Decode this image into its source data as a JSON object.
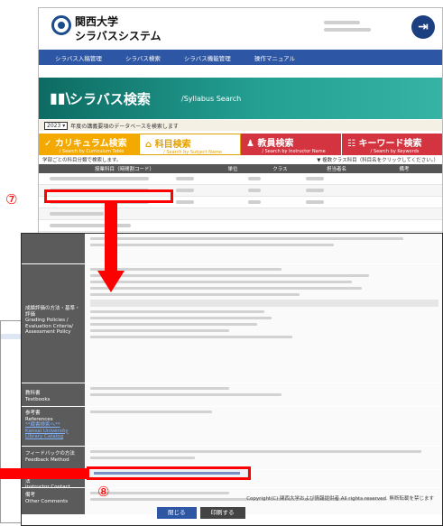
{
  "app": {
    "university": "関西大学",
    "system_name": "シラバスシステム",
    "logout_glyph": "⇥"
  },
  "nav": {
    "items": [
      "シラバス入稿管理",
      "シラバス検索",
      "シラバス機能管理",
      "操作マニュアル"
    ]
  },
  "search": {
    "icon": "books-icon",
    "title": "シラバス検索",
    "subtitle": "/Syllabus Search",
    "year_value": "2023",
    "year_suffix": "年度の講義要項のデータベースを検索します",
    "tabs": [
      {
        "label": "カリキュラム検索",
        "sub": "/ Search by Curriculum Table",
        "glyph": "✓"
      },
      {
        "label": "科目検索",
        "sub": "/ Search by Subject Name",
        "glyph": "⌂"
      },
      {
        "label": "教員検索",
        "sub": "/ Search by Instructor Name",
        "glyph": "♟"
      },
      {
        "label": "キーワード検索",
        "sub": "/ Search by Keywords",
        "glyph": "☷"
      }
    ],
    "note_left": "学部ごとの科目分類で検索します。",
    "note_right": "▼ 複数クラス科目（科目名をクリックしてください。）",
    "columns": [
      "授業科目（時間割コード）",
      "単位",
      "クラス",
      "担当者名",
      "備考"
    ]
  },
  "detail": {
    "rows": [
      {
        "label": ""
      },
      {
        "label": "成績評価の方法・基準・評価\nGrading Policies / Evaluation Criteria/ Assessment Policy"
      },
      {
        "label": "教科書\nTextbooks"
      },
      {
        "label": "参考書\nReferences"
      },
      {
        "link": "**蔵書検索へ**"
      },
      {
        "link": "Kansai University Library Catalog"
      },
      {
        "label": "フィードバックの方法\nFeedback Method"
      },
      {
        "label": "授業者への問い合わせ方法\nInstructor Contact"
      },
      {
        "label": "備考\nOther Comments"
      }
    ],
    "copyright": "Copyright(C) 関西大学および情報提供者  All rights reserved.  無断転載を禁じます",
    "close_button": "閉じる",
    "print_button": "印刷する"
  },
  "annotations": {
    "step7": "⑦",
    "step8": "⑧",
    "color": "#ff0000"
  }
}
